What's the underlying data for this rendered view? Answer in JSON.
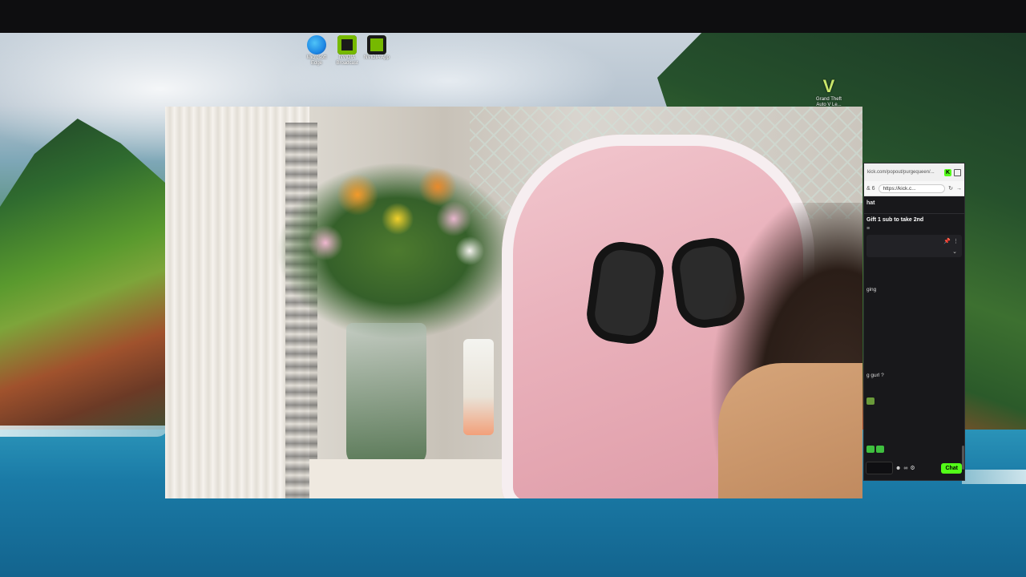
{
  "desktop": {
    "icons": [
      {
        "label": "Microsoft Edge",
        "icon": "edge-icon",
        "color": "#1e88e5"
      },
      {
        "label": "NVIDIA Broadcast",
        "icon": "nvidia-icon",
        "color": "#76b900"
      },
      {
        "label": "NVIDIA App",
        "icon": "nvidia-icon",
        "color": "#76b900"
      },
      {
        "label": "Grand Theft Auto V Le...",
        "icon": "gta-icon",
        "color": "#c8e66a"
      }
    ]
  },
  "chat_window": {
    "tab_url": "kick.com/popout/purgequeen/...",
    "favicon": "K",
    "address_left": "& 6",
    "address_url": "https://kick.c...",
    "header_title": "hat",
    "pinned_message": "Gift 1 sub to take 2nd",
    "filter_icon": "filter-icon",
    "messages": [
      {
        "text": "ging"
      },
      {
        "text": "g gurl ?"
      }
    ],
    "chat_button_label": "Chat",
    "accent_color": "#53fc18"
  }
}
